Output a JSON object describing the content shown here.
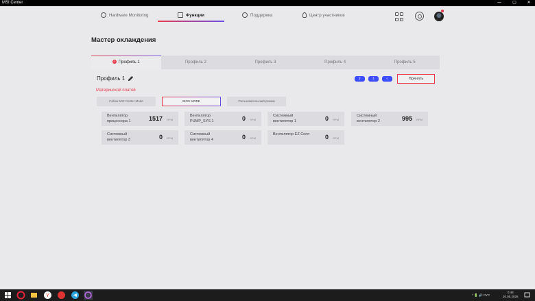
{
  "window": {
    "title": "MSI Center",
    "minimize": "—",
    "maximize": "▢",
    "close": "✕"
  },
  "nav": {
    "items": [
      {
        "label": "Hardware Monitoring"
      },
      {
        "label": "Функции"
      },
      {
        "label": "Поддержка"
      },
      {
        "label": "Центр участников"
      }
    ],
    "active_index": 1
  },
  "page_title": "Мастер охлаждения",
  "tabs": [
    "Профиль 1",
    "Профиль 2",
    "Профиль 3",
    "Профиль 4",
    "Профиль 5"
  ],
  "profile": {
    "name": "Профиль 1",
    "apply_label": "Принять"
  },
  "section_label": "Материнской платой",
  "modes": [
    "Follow MSI Center Mode",
    "BIOS MODE",
    "Пользовательский режим"
  ],
  "fans": [
    {
      "name": "Вентилятор процессора 1",
      "value": "1517",
      "unit": "RPM"
    },
    {
      "name": "Вентилятор PUMP_SYS 1",
      "value": "0",
      "unit": "RPM"
    },
    {
      "name": "Системный вентилятор 1",
      "value": "0",
      "unit": "RPM"
    },
    {
      "name": "Системный вентилятор 2",
      "value": "995",
      "unit": "RPM"
    },
    {
      "name": "Системный вентилятор 3",
      "value": "0",
      "unit": "RPM"
    },
    {
      "name": "Системный вентилятор 4",
      "value": "0",
      "unit": "RPM"
    },
    {
      "name": "Вентилятор EZ Conn",
      "value": "0",
      "unit": "RPM"
    }
  ],
  "taskbar": {
    "tray": "^ 🔋 🔊 РУС",
    "time": "0:48",
    "date": "20.05.2026"
  },
  "colors": {
    "accent_red": "#e8394d",
    "accent_blue": "#3c4cff"
  }
}
